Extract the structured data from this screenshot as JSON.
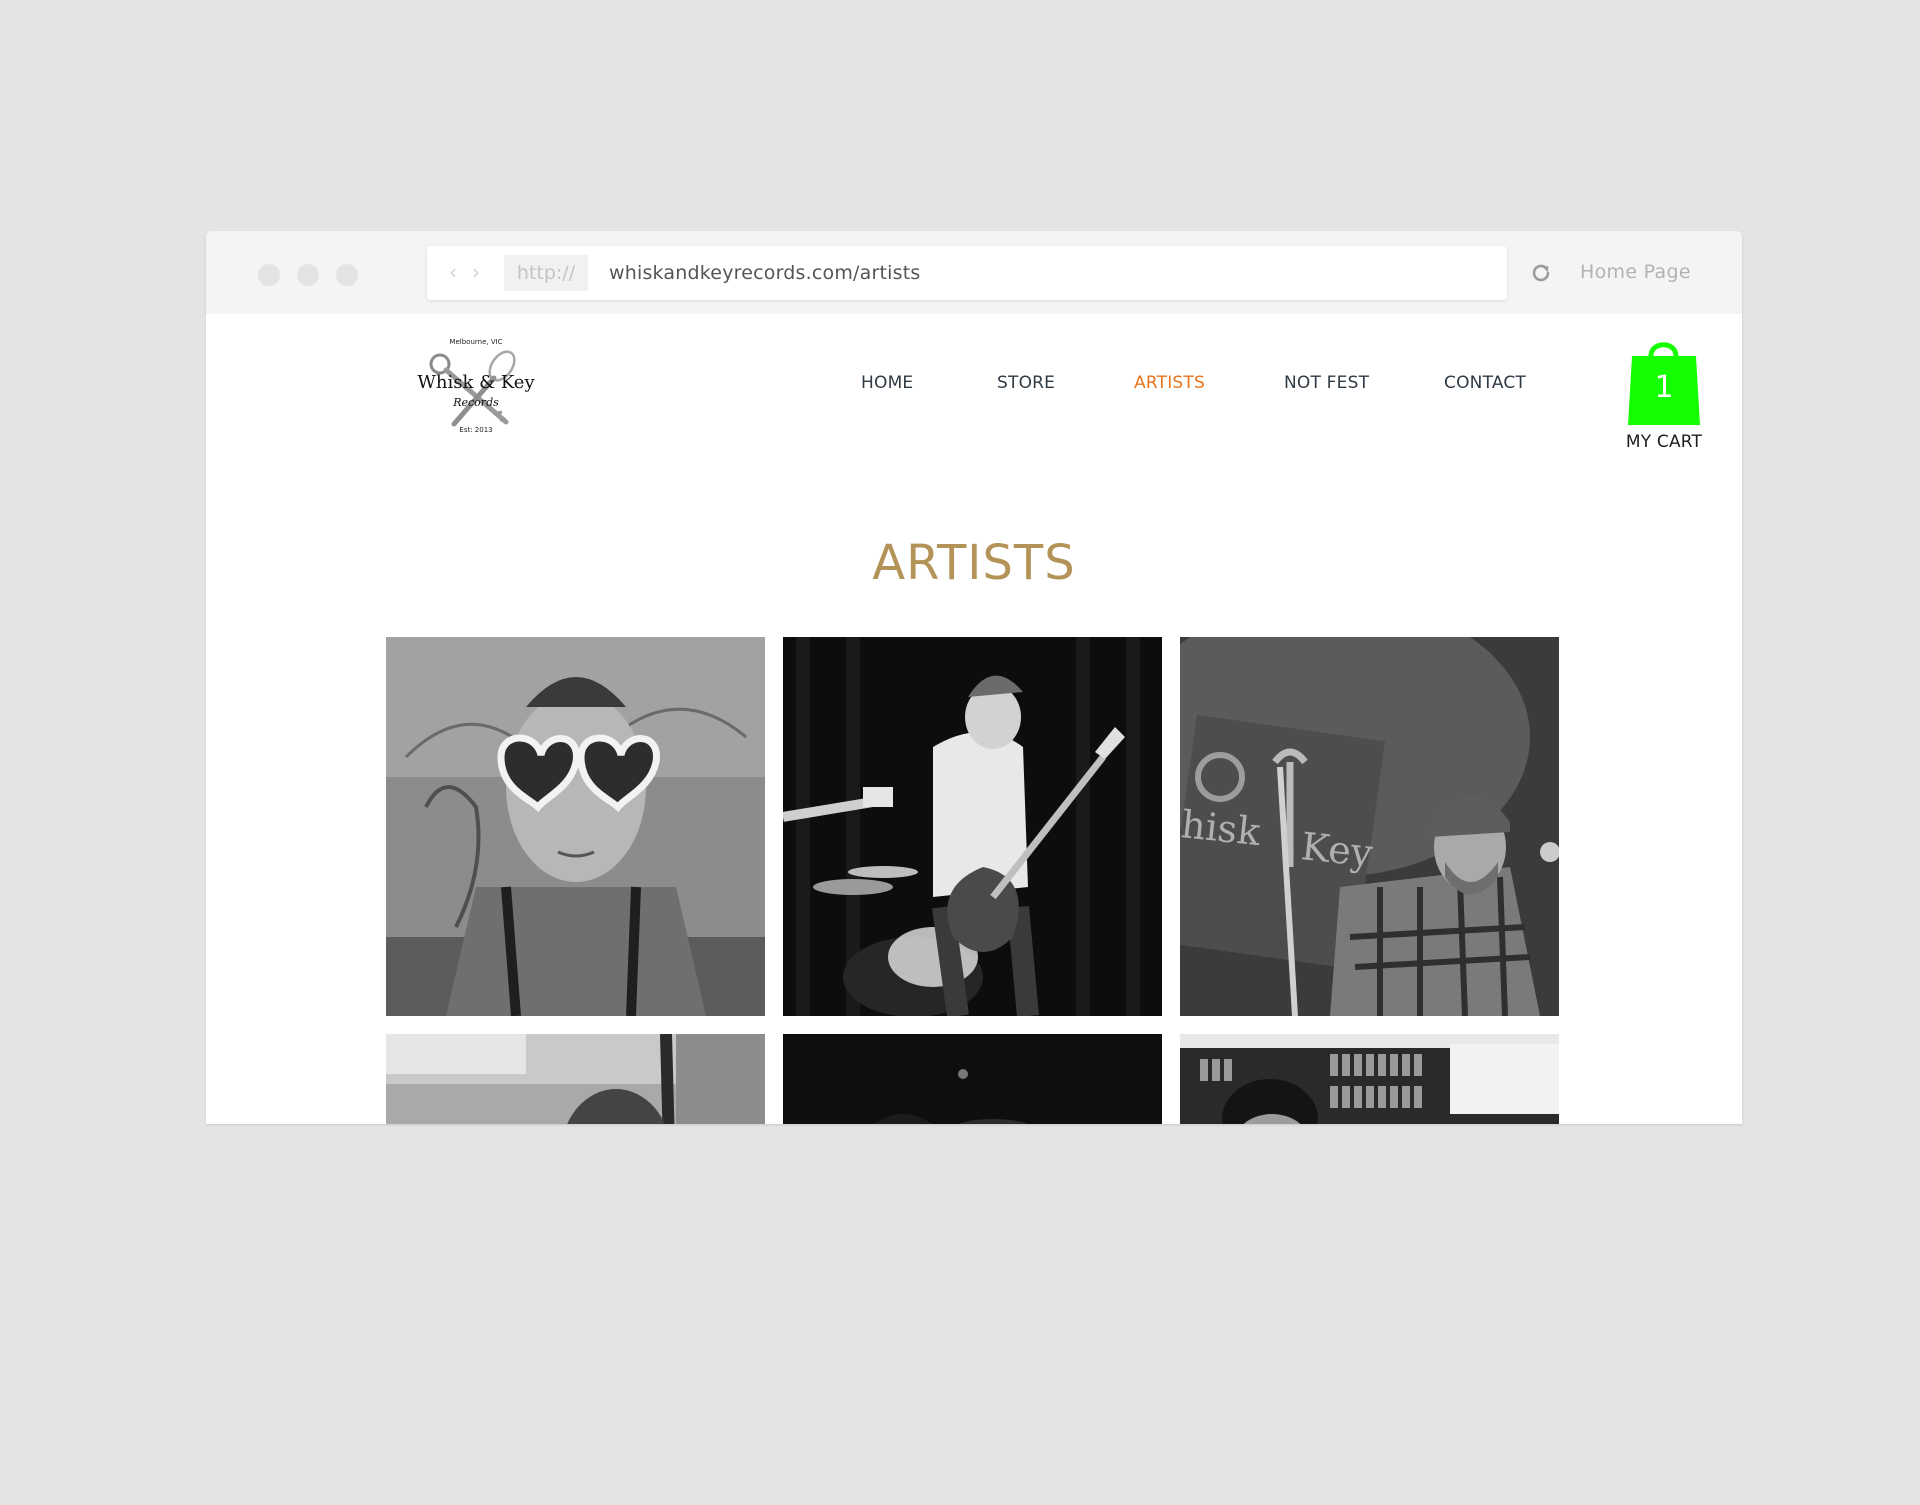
{
  "browser": {
    "protocol": "http://",
    "url": "whiskandkeyrecords.com/artists",
    "home_label": "Home Page"
  },
  "logo": {
    "top_text": "Melbourne, VIC",
    "name": "Whisk & Key",
    "sub": "Records",
    "est": "Est: 2013"
  },
  "nav": {
    "items": [
      {
        "label": "HOME"
      },
      {
        "label": "STORE"
      },
      {
        "label": "ARTISTS",
        "active": true
      },
      {
        "label": "NOT FEST"
      },
      {
        "label": "CONTACT"
      }
    ],
    "active_color": "#e8741b",
    "text_color": "#2f3a45"
  },
  "cart": {
    "count": "1",
    "label": "MY CART",
    "color": "#16ff00"
  },
  "main": {
    "title": "ARTISTS",
    "title_color": "#b49358"
  },
  "artists": [
    {
      "image": "portrait-heart-sunglasses"
    },
    {
      "image": "bassist-on-stage"
    },
    {
      "image": "musician-beanie-plaid-shirt"
    },
    {
      "image": "portrait-outdoor"
    },
    {
      "image": "dark-stage-photo"
    },
    {
      "image": "portrait-record-shelves"
    }
  ]
}
